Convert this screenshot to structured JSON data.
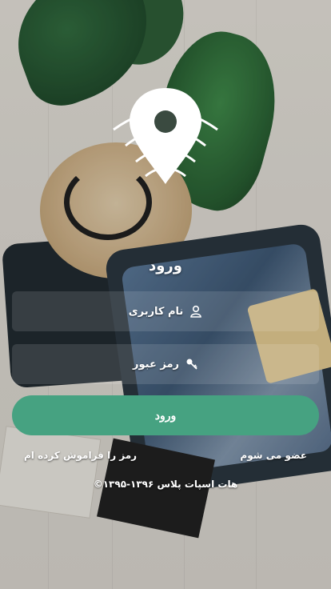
{
  "login": {
    "title": "ورود",
    "username_placeholder": "نام کاربری",
    "password_placeholder": "رمز عبور",
    "submit_label": "ورود",
    "join_link": "عضو می شوم",
    "forgot_link": "رمز را فراموش کرده ام",
    "copyright": "©۱۳۹۵-۱۳۹۶ هات اسپات پلاس"
  },
  "icons": {
    "logo": "location-wifi-logo",
    "user": "user-icon",
    "password": "key-icon"
  },
  "colors": {
    "accent": "#46a281",
    "text": "#ffffff"
  }
}
